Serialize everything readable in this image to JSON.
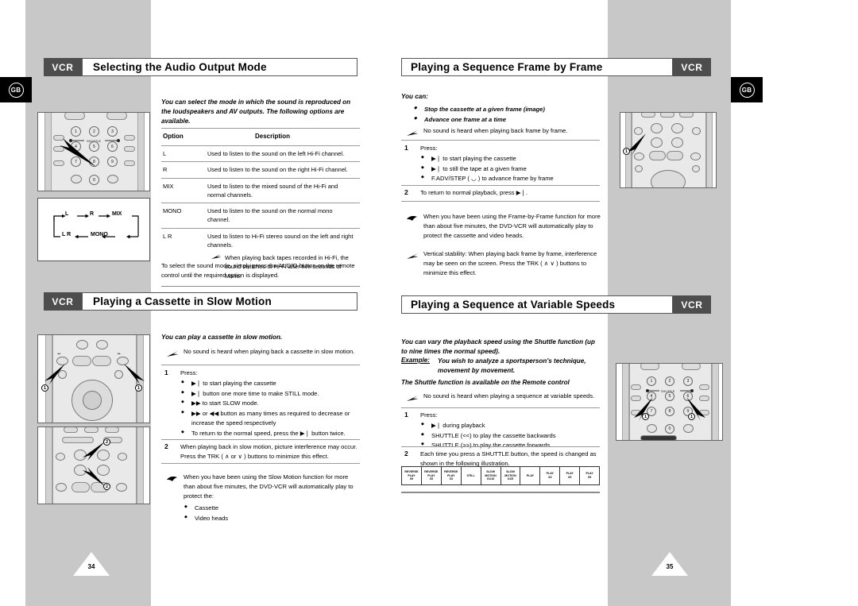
{
  "document": {
    "left_page_number": "34",
    "right_page_number": "35",
    "region_badge": "GB",
    "vcr_tag": "VCR"
  },
  "sections": {
    "audio_output": {
      "title": "Selecting the Audio Output Mode",
      "intro": "You can select the mode in which the sound is reproduced on the loudspeakers and AV outputs. The following options are available.",
      "table": {
        "headers": [
          "Option",
          "Description"
        ],
        "rows": [
          {
            "option": "L",
            "description": "Used to listen to the sound on the left Hi-Fi channel."
          },
          {
            "option": "R",
            "description": "Used to listen to the sound on the right Hi-Fi channel."
          },
          {
            "option": "MIX",
            "description": "Used to listen to the mixed sound of the Hi-Fi and normal channels."
          },
          {
            "option": "MONO",
            "description": "Used to listen to the sound on the normal mono channel."
          },
          {
            "option": "L R",
            "description": "Used to listen to Hi-Fi stereo sound on the left and right channels."
          }
        ],
        "sub_note": "When playing back tapes recorded in Hi-Fi, the sound switches to Hi-Fi after five seconds of Mono."
      },
      "footer": "To select the sound mode, simply press the AUDIO button on the remote control until the required option is displayed.",
      "cycle_diagram": {
        "top_row": [
          "L",
          "R",
          "MIX"
        ],
        "bottom_row": [
          "L R",
          "MONO"
        ]
      }
    },
    "slow_motion": {
      "title": "Playing a Cassette in Slow Motion",
      "intro": "You can play a cassette in slow motion.",
      "arrow_note": "No sound is heard when playing back a cassette in slow motion.",
      "step1_label": "1",
      "step1_title": "Press:",
      "step1_bullets": [
        "▶❘ to start playing the cassette",
        "▶❘ button one more time to make STILL mode.",
        "▶▶ to start SLOW mode.",
        "▶▶ or ◀◀ button as many times as required to decrease or increase the speed respectively",
        "To return to the normal speed, press the ▶❘ button twice."
      ],
      "step2_label": "2",
      "step2_text": "When playing back in slow motion, picture interference may occur. Press the TRK ( ∧ or ∨ ) buttons to minimize this effect.",
      "hand_note": "When you have been using the Slow Motion function for more than about five minutes, the DVD-VCR will automatically play to protect the:",
      "hand_note_bullets": [
        "Cassette",
        "Video heads"
      ]
    },
    "frame_by_frame": {
      "title": "Playing a Sequence Frame by Frame",
      "intro": "You can:",
      "intro_bullets": [
        "Stop the cassette at a given frame (image)",
        "Advance one frame at a time"
      ],
      "arrow_note": "No sound is heard when playing back frame by frame.",
      "step1_label": "1",
      "step1_title": "Press:",
      "step1_bullets": [
        "▶❘ to start playing the cassette",
        "▶❘ to still the tape at a given frame",
        "F.ADV/STEP ( ◡ ) to advance frame by frame"
      ],
      "step2_label": "2",
      "step2_text": "To return to normal playback, press ▶❘.",
      "hand_note": "When you have been using the Frame-by-Frame function for more than about five minutes, the DVD-VCR will automatically play to protect the cassette and video heads.",
      "arrow_note2": "Vertical stability: When playing back frame by frame, interference may be seen on the screen. Press the TRK ( ∧ ∨ ) buttons to minimize this effect."
    },
    "variable_speeds": {
      "title": "Playing a Sequence at Variable Speeds",
      "intro": "You can vary the playback speed using the Shuttle function (up to nine times the normal speed).",
      "example_label": "Example:",
      "example_text": "You wish to analyze a sportsperson's technique, movement by movement.",
      "availability": "The Shuttle function is available on the Remote control",
      "arrow_note": "No sound is heard when playing a sequence at variable speeds.",
      "step1_label": "1",
      "step1_title": "Press:",
      "step1_bullets": [
        "▶❘ during playback",
        "SHUTTLE (<<) to play the cassette backwards",
        "SHUTTLE (>>) to play the cassette forwards"
      ],
      "step2_label": "2",
      "step2_text": "Each time you press a SHUTTLE button, the speed is changed as shown in the following illustration.",
      "speed_strip": [
        "REVERSE\nPLAY\nX9",
        "REVERSE\nPLAY\nX5",
        "REVERSE\nPLAY\nX3",
        "STILL",
        "SLOW\nMOTION\nX1/10",
        "SLOW\nMOTION\nX1/5",
        "PLAY",
        "PLAY\nX3",
        "PLAY\nX5",
        "PLAY\nX9"
      ]
    }
  },
  "remotes": {
    "audio_remote_labels": [
      "1",
      "2",
      "3",
      "4",
      "5",
      "6",
      "7",
      "8",
      "9",
      "0"
    ],
    "shuttle_label": "SHUTTLE",
    "callout_1": "1",
    "callout_2": "2"
  }
}
